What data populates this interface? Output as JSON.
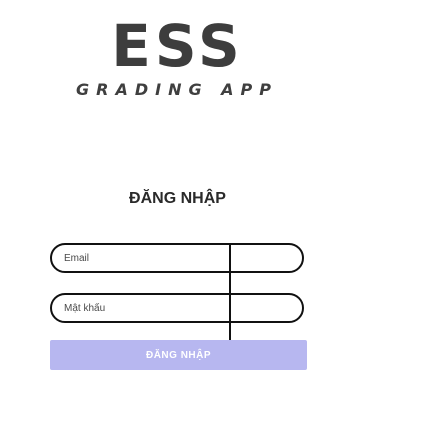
{
  "logo": {
    "title": "ESS",
    "subtitle": "GRADING APP"
  },
  "login": {
    "heading": "ĐĂNG NHẬP",
    "email_placeholder": "Email",
    "email_value": "",
    "password_placeholder": "Mật khẩu",
    "password_value": "",
    "submit_label": "ĐĂNG NHẬP"
  },
  "colors": {
    "button_background": "#b7b7f0",
    "button_text": "#ffffff",
    "field_border": "#111111",
    "text_dark": "#2a2a2a"
  }
}
